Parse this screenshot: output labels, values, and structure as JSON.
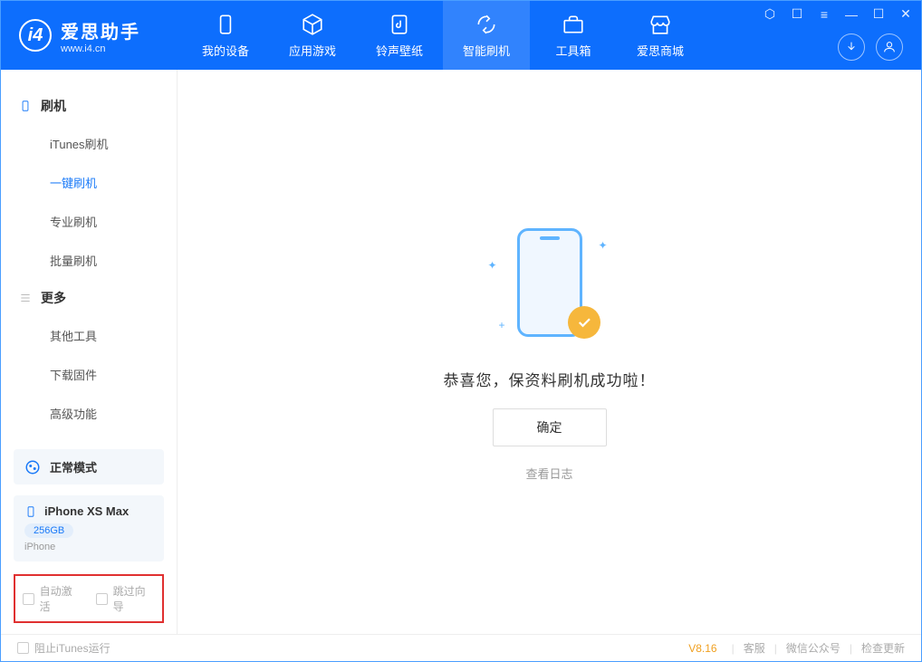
{
  "logo": {
    "title": "爱思助手",
    "url": "www.i4.cn"
  },
  "tabs": [
    {
      "label": "我的设备",
      "icon": "device"
    },
    {
      "label": "应用游戏",
      "icon": "cube"
    },
    {
      "label": "铃声壁纸",
      "icon": "music"
    },
    {
      "label": "智能刷机",
      "icon": "refresh",
      "active": true
    },
    {
      "label": "工具箱",
      "icon": "toolbox"
    },
    {
      "label": "爱思商城",
      "icon": "store"
    }
  ],
  "sidebar": {
    "group1_title": "刷机",
    "items1": [
      "iTunes刷机",
      "一键刷机",
      "专业刷机",
      "批量刷机"
    ],
    "group2_title": "更多",
    "items2": [
      "其他工具",
      "下载固件",
      "高级功能"
    ],
    "active_item": "一键刷机"
  },
  "mode_card": {
    "label": "正常模式"
  },
  "device_card": {
    "name": "iPhone XS Max",
    "storage": "256GB",
    "type": "iPhone"
  },
  "bottom_checks": {
    "auto_activate": "自动激活",
    "skip_guide": "跳过向导"
  },
  "main": {
    "success_text": "恭喜您，保资料刷机成功啦！",
    "ok_button": "确定",
    "log_link": "查看日志"
  },
  "footer": {
    "block_itunes": "阻止iTunes运行",
    "version": "V8.16",
    "links": [
      "客服",
      "微信公众号",
      "检查更新"
    ]
  }
}
